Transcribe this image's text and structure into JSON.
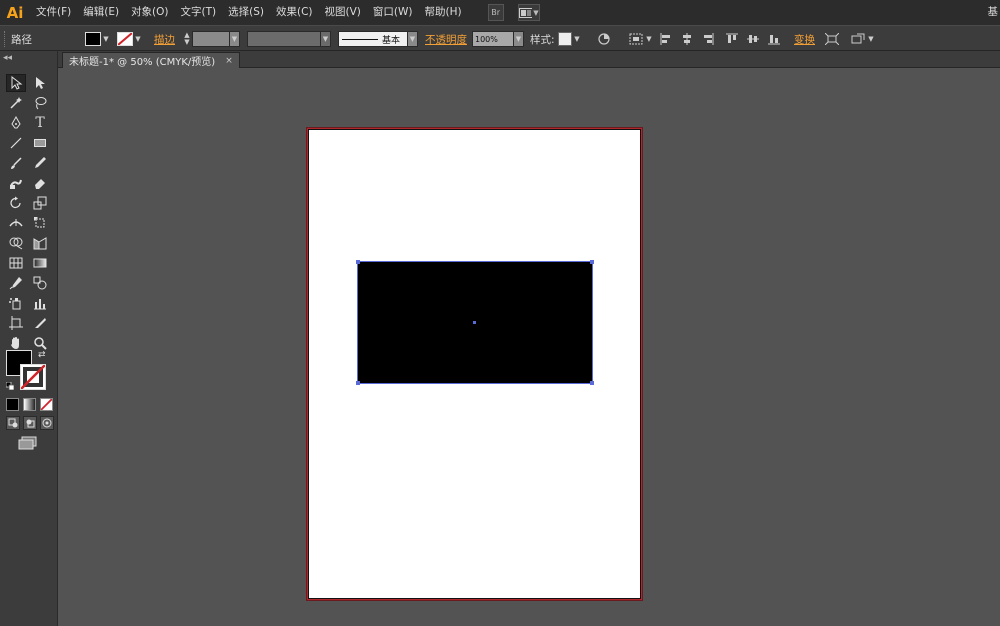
{
  "app": {
    "logo": "Ai",
    "workspace": "基"
  },
  "menu": [
    "文件(F)",
    "编辑(E)",
    "对象(O)",
    "文字(T)",
    "选择(S)",
    "效果(C)",
    "视图(V)",
    "窗口(W)",
    "帮助(H)"
  ],
  "menubar_buttons": {
    "bridge": "Br"
  },
  "control": {
    "selection_label": "路径",
    "stroke_label": "描边",
    "profile_label": "基本",
    "opacity_label": "不透明度",
    "opacity_value": "100%",
    "style_label": "样式:",
    "transform_label": "变换",
    "fill_color": "#000000"
  },
  "document_tab": {
    "title": "未标题-1* @ 50% (CMYK/预览)",
    "close": "×"
  },
  "toolbox": {
    "collapse": "◂◂",
    "fill_color": "#000000",
    "stroke_color": "none"
  },
  "colors": {
    "accent": "#f3a036",
    "artboard_border": "#b0262d",
    "selection": "#5a6bd8",
    "shape_fill": "#000000"
  }
}
